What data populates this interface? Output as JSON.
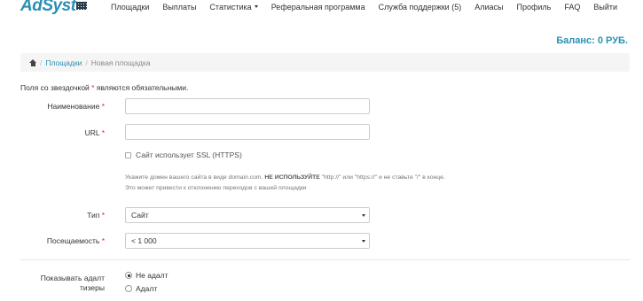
{
  "app": {
    "logo_text": "AdSyst"
  },
  "nav": {
    "items": [
      "Площадки",
      "Выплаты",
      "Статистика",
      "Реферальная программа",
      "Служба поддержки (5)",
      "Алиасы",
      "Профиль",
      "FAQ",
      "Выйти"
    ]
  },
  "balance": "Баланс: 0 РУБ.",
  "breadcrumb": {
    "sep": "/",
    "link": "Площадки",
    "current": "Новая площадка"
  },
  "required_note": {
    "before": "Поля со звездочкой ",
    "star": "*",
    "after": " являются обязательными."
  },
  "form": {
    "name_label": "Наименование",
    "url_label": "URL",
    "required_star": "*",
    "ssl_label": "Сайт использует SSL (HTTPS)",
    "hint_line1_a": "Укажите домен вашего сайта в виде domain.com. ",
    "hint_line1_b": "НЕ ИСПОЛЬЗУЙТЕ",
    "hint_line1_c": " \"http://\" или \"https://\" и не ставьте \"/\" в конце.",
    "hint_line2": "Это может привести к отклонению переходов с вашей площадки",
    "type_label": "Тип",
    "type_value": "Сайт",
    "traffic_label": "Посещаемость",
    "traffic_value": "< 1 000",
    "adult_label_line1": "Показывать адалт",
    "adult_label_line2": "тизеры",
    "adult_options": [
      "Не адалт",
      "Адалт"
    ],
    "adult_selected": "Не адалт"
  }
}
